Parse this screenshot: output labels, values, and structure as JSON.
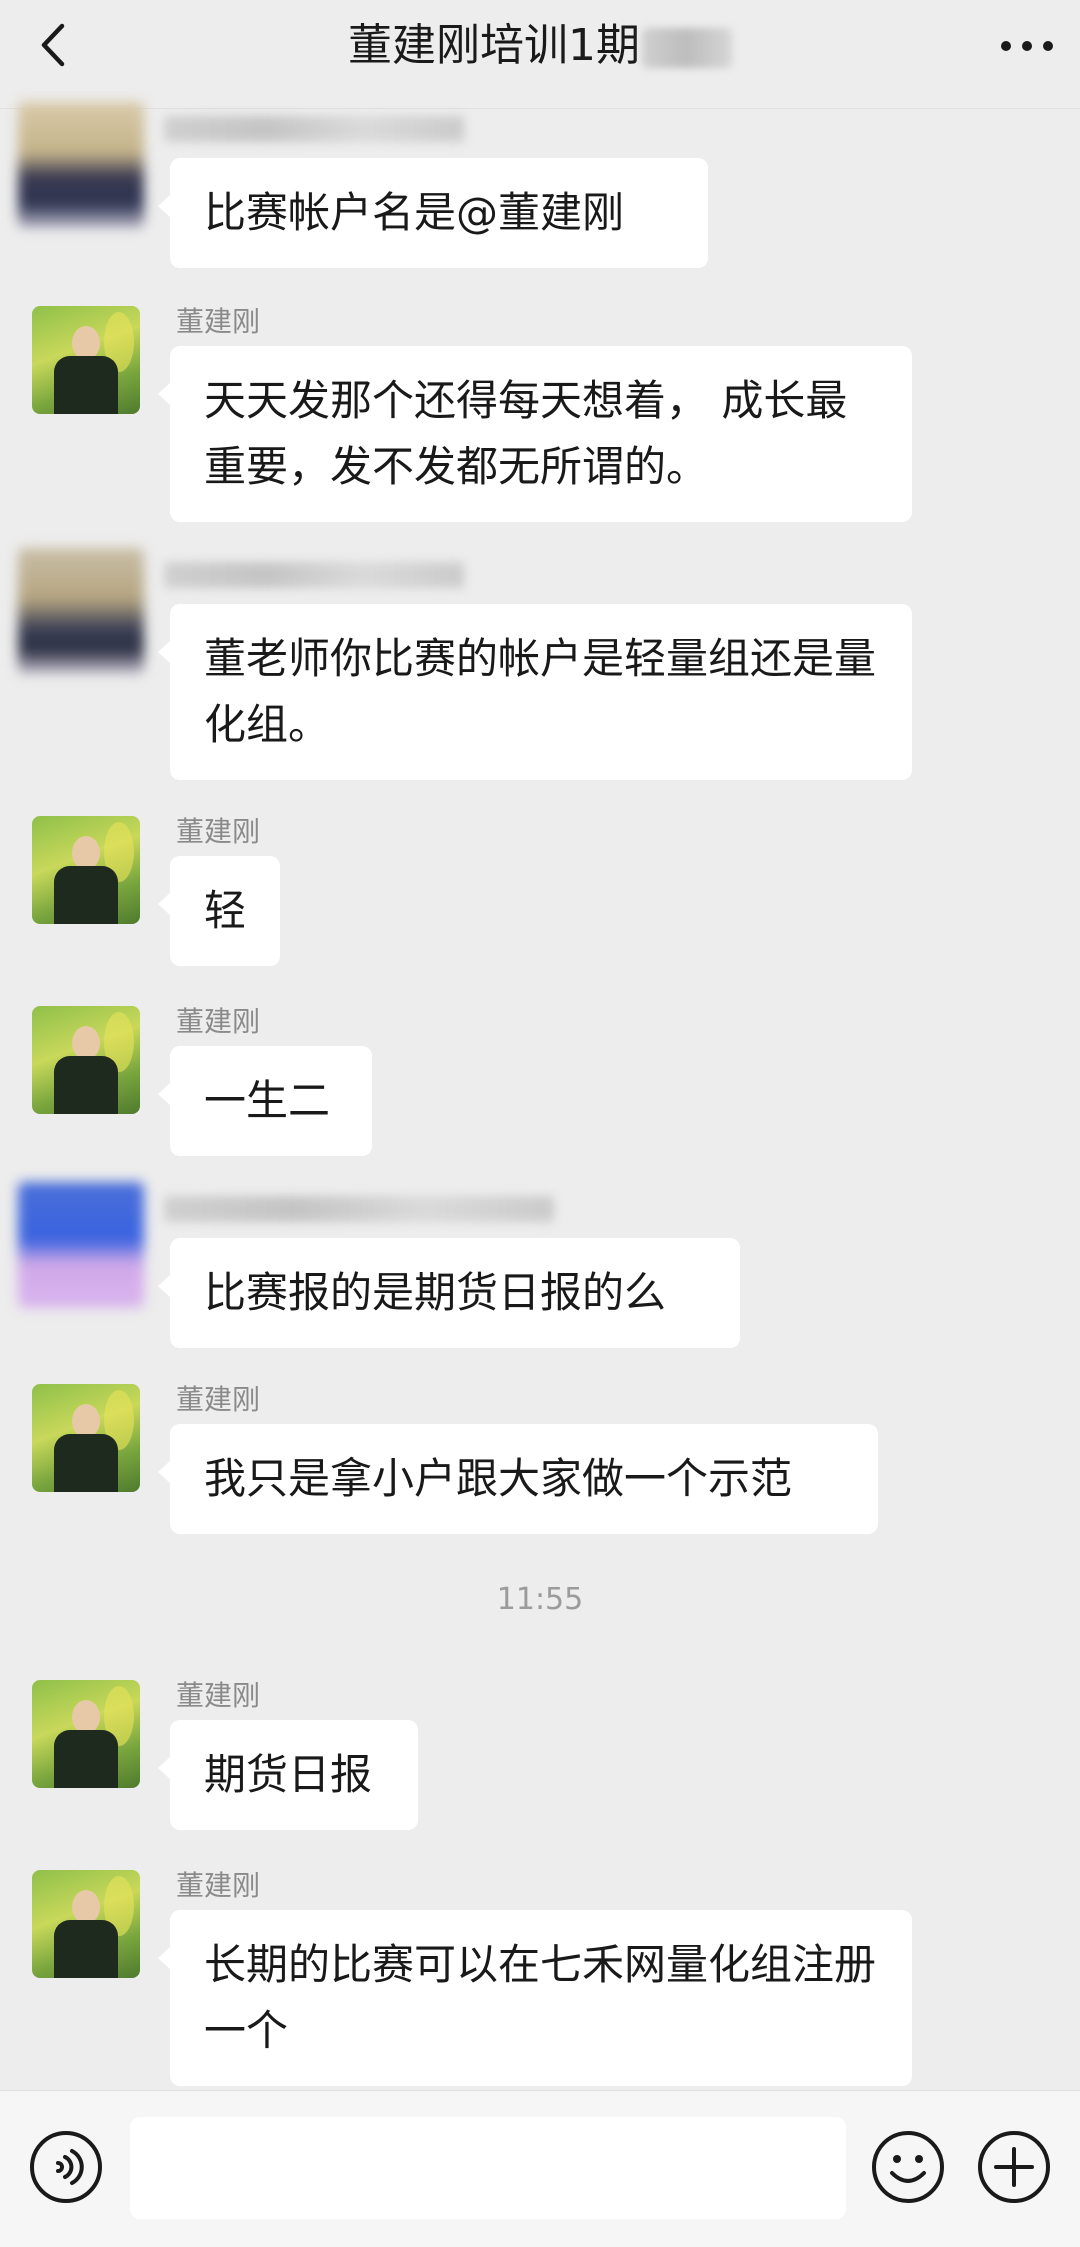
{
  "header": {
    "title": "董建刚培训1期",
    "back_icon": "chevron-left-icon",
    "more_icon": "more-dots-icon"
  },
  "messages": [
    {
      "sender": "",
      "text": "比赛帐户名是@董建刚"
    },
    {
      "sender": "董建刚",
      "text": "天天发那个还得每天想着， 成长最重要，发不发都无所谓的。"
    },
    {
      "sender": "",
      "text": "董老师你比赛的帐户是轻量组还是量化组。"
    },
    {
      "sender": "董建刚",
      "text": "轻"
    },
    {
      "sender": "董建刚",
      "text": "一生二"
    },
    {
      "sender": "",
      "text": "比赛报的是期货日报的么"
    },
    {
      "sender": "董建刚",
      "text": "我只是拿小户跟大家做一个示范"
    },
    {
      "timestamp": "11:55"
    },
    {
      "sender": "董建刚",
      "text": "期货日报"
    },
    {
      "sender": "董建刚",
      "text": "长期的比赛可以在七禾网量化组注册一个"
    }
  ],
  "inputbar": {
    "voice_icon": "voice-icon",
    "input_value": "",
    "emoji_icon": "emoji-icon",
    "plus_icon": "plus-icon"
  },
  "colors": {
    "background": "#ededed",
    "bubble": "#ffffff",
    "name_text": "#8a8a8a",
    "timestamp_text": "#9b9b9b"
  }
}
